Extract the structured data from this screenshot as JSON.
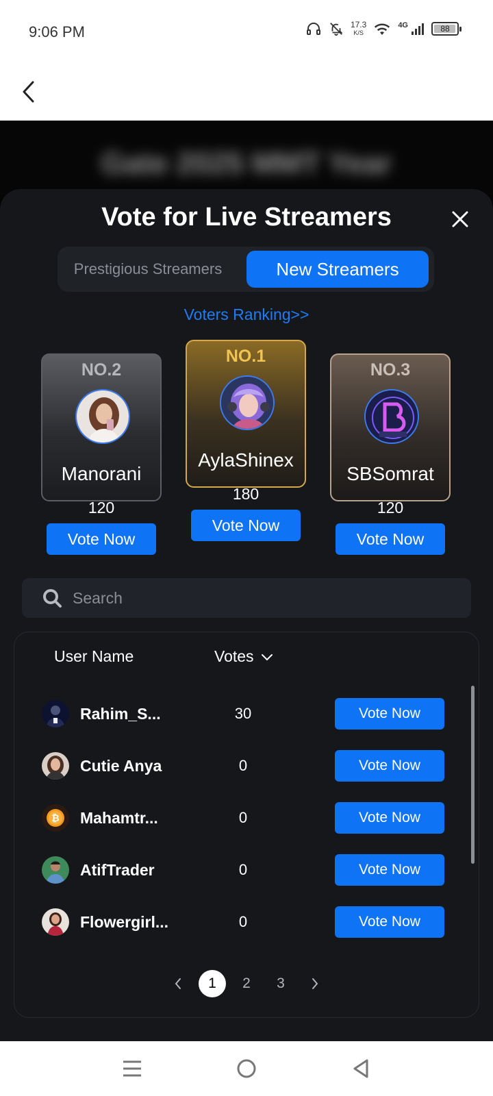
{
  "status_bar": {
    "time": "9:06 PM",
    "net_speed_value": "17.3",
    "net_speed_unit": "K/S",
    "network_type": "4G",
    "battery_level": "88"
  },
  "background": {
    "blurred_title": "Gate 2025 MMT Year"
  },
  "modal": {
    "title": "Vote for Live Streamers",
    "tabs": {
      "prestigious": "Prestigious Streamers",
      "new": "New Streamers",
      "active": "new"
    },
    "voters_ranking_link": "Voters Ranking>>",
    "podium": {
      "first": {
        "rank": "NO.1",
        "name": "AylaShinex",
        "votes": "180",
        "button": "Vote Now"
      },
      "second": {
        "rank": "NO.2",
        "name": "Manorani",
        "votes": "120",
        "button": "Vote Now"
      },
      "third": {
        "rank": "NO.3",
        "name": "SBSomrat",
        "votes": "120",
        "button": "Vote Now"
      }
    },
    "search": {
      "placeholder": "Search"
    },
    "table": {
      "headers": {
        "user": "User Name",
        "votes": "Votes"
      },
      "rows": [
        {
          "name": "Rahim_S...",
          "votes": "30",
          "button": "Vote Now"
        },
        {
          "name": "Cutie Anya",
          "votes": "0",
          "button": "Vote Now"
        },
        {
          "name": "Mahamtr...",
          "votes": "0",
          "button": "Vote Now"
        },
        {
          "name": "AtifTrader",
          "votes": "0",
          "button": "Vote Now"
        },
        {
          "name": "Flowergirl...",
          "votes": "0",
          "button": "Vote Now"
        }
      ]
    },
    "pagination": {
      "pages": [
        "1",
        "2",
        "3"
      ],
      "current": "1"
    }
  },
  "colors": {
    "accent": "#0f73f5",
    "sheet_bg": "#15171b",
    "gold": "#f0c452"
  }
}
